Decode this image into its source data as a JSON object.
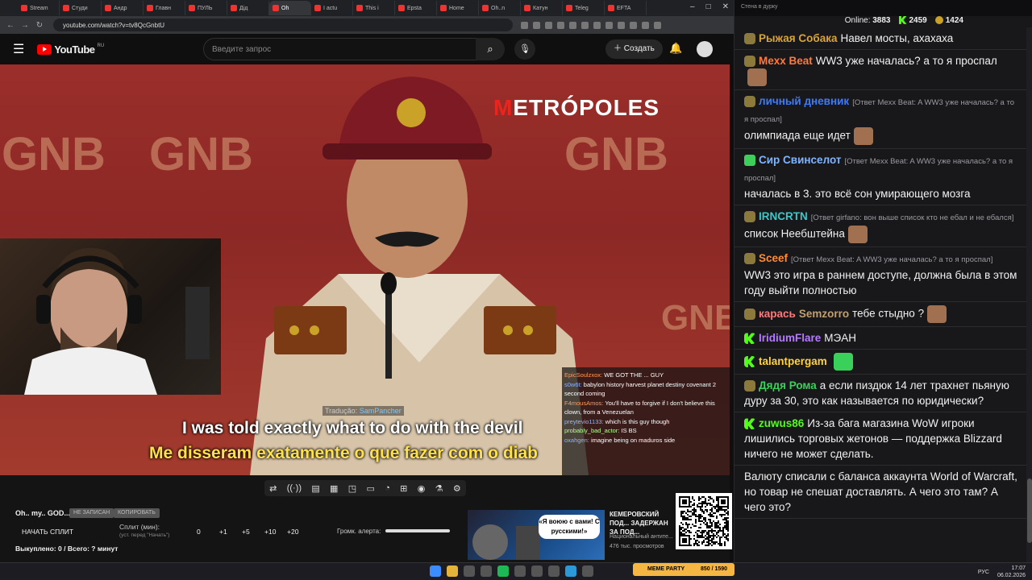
{
  "browser": {
    "tabs": [
      "Stream",
      "Студи",
      "Андр",
      "Главн",
      "ПУЛЬ",
      "Дід",
      "Oh",
      "I actu",
      "This i",
      "Epsta",
      "Home",
      "Oh..n",
      "Катун",
      "Teleg",
      "EFTA"
    ],
    "active_tab_index": 6,
    "url": "youtube.com/watch?v=tv8QcGnbtU",
    "window_controls": [
      "–",
      "□",
      "✕"
    ]
  },
  "youtube": {
    "logo_text": "YouTube",
    "region": "RU",
    "search_placeholder": "Введите запрос",
    "create_label": "Создать"
  },
  "video": {
    "watermark_left": "GNB",
    "watermark_right": "GNB",
    "watermark_bottom": "GNB",
    "brand_first": "M",
    "brand_rest": "ETRÓPOLES",
    "translation_label": "Tradução:",
    "translation_name": "SamPancher",
    "subtitle_en": "I was told exactly what to do with the devil",
    "subtitle_pt": "Me disseram exatamente o que fazer com o diab",
    "overlay_chat": [
      {
        "user": "EpicSoulzxox:",
        "text": "WE GOT THE ... GUY"
      },
      {
        "user": "s0w6t:",
        "text": "babylon history harvest planet destiny covenant 2 second coming"
      },
      {
        "user": "F4mousAmos:",
        "text": "You'll have to forgive if I don't believe this clown, from a Venezuelan"
      },
      {
        "user": "preytevio1133:",
        "text": "which is this guy though"
      },
      {
        "user": "probably_bad_actor:",
        "text": "IS BS"
      },
      {
        "user": "oxahgen:",
        "text": "imagine being on maduros side"
      }
    ]
  },
  "controls": {
    "stream_title": "Oh.. my.. GOD...",
    "pill1": "НЕ ЗАПИСАН",
    "pill2": "КОПИРОВАТЬ",
    "split_button": "НАЧАТЬ СПЛИТ",
    "split_label": "Сплит (мин):",
    "split_hint": "(уст. перед \"Начать\")",
    "split_values": [
      "0",
      "+1",
      "+5",
      "+10",
      "+20"
    ],
    "volume_label": "Громк. алерта:",
    "volume_level": 1.0,
    "bought": "Выкуплено: 0 / Всего: ? минут"
  },
  "recommend": {
    "bubble_text": "«Я воюю с вами! С русскими!»",
    "title": "КЕМЕРОВСКИЙ ПОД... ЗАДЕРЖАН ЗА ПОД...",
    "channel": "Национальный антите...",
    "views": "476 тыс. просмотров"
  },
  "chat": {
    "header": "Стена в дурку",
    "online_label": "Online:",
    "online_count": "3883",
    "kick_count": "2459",
    "coin_count": "1424",
    "messages": [
      {
        "name": "Рыжая Собака",
        "color": "#d9a43a",
        "text": "Навел мосты, ахахаха",
        "reply": ""
      },
      {
        "name": "Mexx Beat",
        "color": "#ff7a3a",
        "text": "WW3 уже началась? а то я проспал",
        "reply": ""
      },
      {
        "name": "личный дневник",
        "color": "#3a7bff",
        "text": "олимпиада еще идет",
        "reply": "[Ответ Mexx Beat: A WW3 уже началась? а то я проспал]"
      },
      {
        "name": "Сир Свинселот",
        "color": "#7fb4ff",
        "text": "началась в 3. это всё сон умирающего мозга",
        "reply": "[Ответ Mexx Beat: A WW3 уже началась? а то я проспал]"
      },
      {
        "name": "IRNCRTN",
        "color": "#3ac9c9",
        "text": "список Неебштейна",
        "reply": "[Ответ girfano: вон выше список кто не ебал и не ебался]"
      },
      {
        "name": "Sceef",
        "color": "#ff8a3a",
        "text": "WW3 это игра в раннем доступе, должна была в этом году выйти полностью",
        "reply": "[Ответ Mexx Beat: A WW3 уже началась? а то я проспал]"
      },
      {
        "name": "карась",
        "color": "#ff7a7a",
        "name2": "Semzorro",
        "name2_color": "#c0a070",
        "text": "тебе стыдно ?",
        "reply": ""
      },
      {
        "name": "IridiumFlare",
        "color": "#b57aff",
        "text": "МЭАН",
        "reply": ""
      },
      {
        "name": "talantpergam",
        "color": "#ffd23a",
        "text": "",
        "reply": ""
      },
      {
        "name": "Дядя Рома",
        "color": "#3ad15a",
        "text": "а если пиздюк 14 лет трахнет пьяную дуру за 30, это как называется по юридически?",
        "reply": ""
      },
      {
        "name": "zuwus86",
        "color": "#53fc18",
        "text": "Из-за бага магазина WoW игроки лишились торговых жетонов — поддержка Blizzard ничего не может сделать.",
        "reply": ""
      },
      {
        "name": "",
        "color": "#ffffff",
        "text": "Валюту списали с баланса аккаунта World of Warcraft, но товар не спешат доставлять. А чего это там? А чего это?",
        "reply": ""
      }
    ]
  },
  "taskbar": {
    "meme_label": "MEME PARTY",
    "meme_count": "850 / 1590",
    "lang": "РУС",
    "time": "17:07",
    "date": "06.02.2026"
  }
}
